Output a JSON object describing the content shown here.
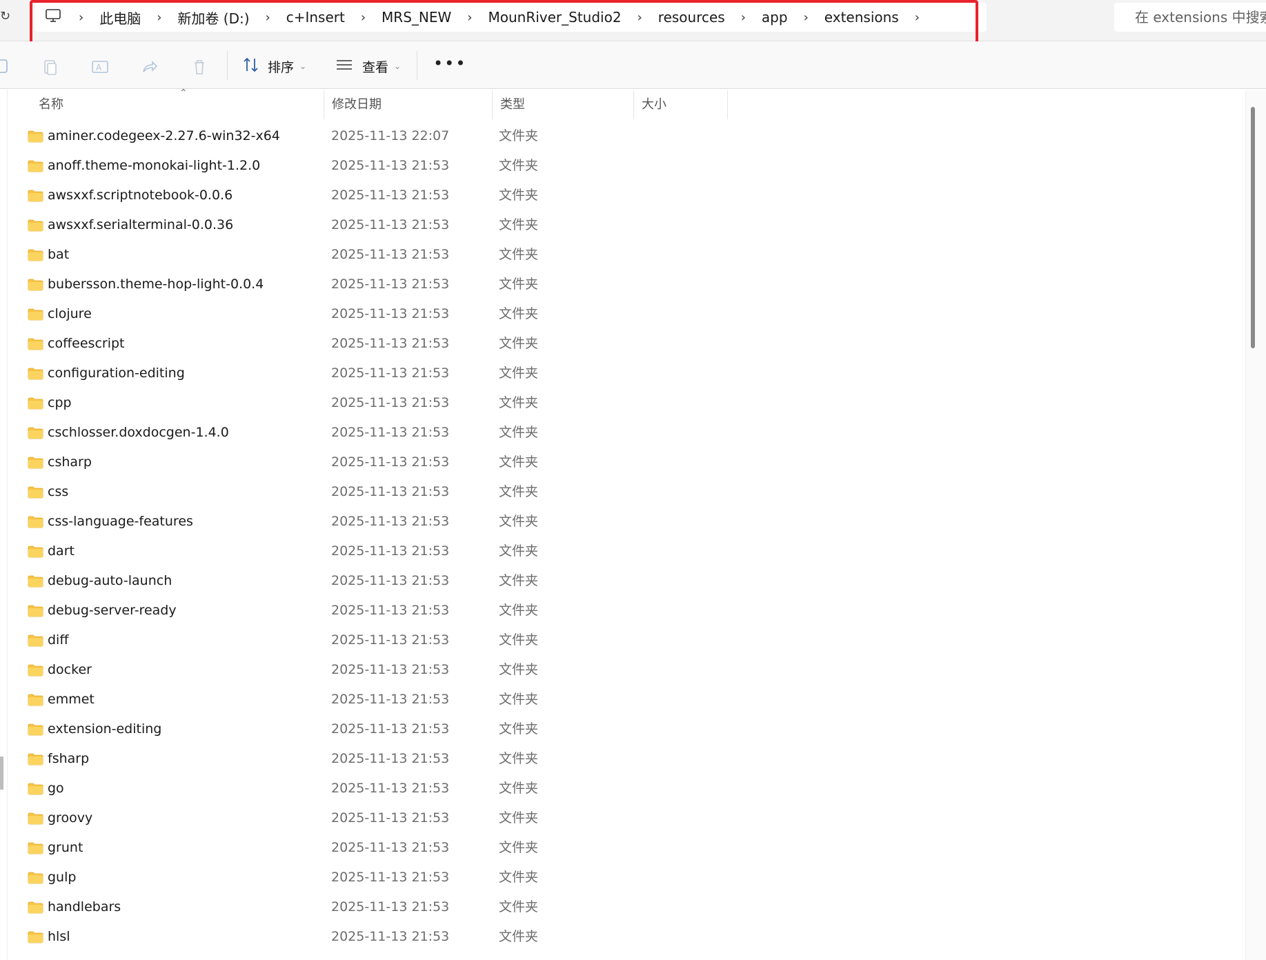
{
  "address_bar": {
    "segments": [
      "此电脑",
      "新加卷 (D:)",
      "c+Insert",
      "MRS_NEW",
      "MounRiver_Studio2",
      "resources",
      "app",
      "extensions"
    ],
    "search_placeholder": "在 extensions 中搜索"
  },
  "toolbar": {
    "sort_label": "排序",
    "view_label": "查看",
    "more_label": "•••"
  },
  "columns": {
    "name": "名称",
    "date": "修改日期",
    "type": "类型",
    "size": "大小"
  },
  "files": [
    {
      "name": "aminer.codegeex-2.27.6-win32-x64",
      "date": "2025-11-13 22:07",
      "type": "文件夹"
    },
    {
      "name": "anoff.theme-monokai-light-1.2.0",
      "date": "2025-11-13 21:53",
      "type": "文件夹"
    },
    {
      "name": "awsxxf.scriptnotebook-0.0.6",
      "date": "2025-11-13 21:53",
      "type": "文件夹"
    },
    {
      "name": "awsxxf.serialterminal-0.0.36",
      "date": "2025-11-13 21:53",
      "type": "文件夹"
    },
    {
      "name": "bat",
      "date": "2025-11-13 21:53",
      "type": "文件夹"
    },
    {
      "name": "bubersson.theme-hop-light-0.0.4",
      "date": "2025-11-13 21:53",
      "type": "文件夹"
    },
    {
      "name": "clojure",
      "date": "2025-11-13 21:53",
      "type": "文件夹"
    },
    {
      "name": "coffeescript",
      "date": "2025-11-13 21:53",
      "type": "文件夹"
    },
    {
      "name": "configuration-editing",
      "date": "2025-11-13 21:53",
      "type": "文件夹"
    },
    {
      "name": "cpp",
      "date": "2025-11-13 21:53",
      "type": "文件夹"
    },
    {
      "name": "cschlosser.doxdocgen-1.4.0",
      "date": "2025-11-13 21:53",
      "type": "文件夹"
    },
    {
      "name": "csharp",
      "date": "2025-11-13 21:53",
      "type": "文件夹"
    },
    {
      "name": "css",
      "date": "2025-11-13 21:53",
      "type": "文件夹"
    },
    {
      "name": "css-language-features",
      "date": "2025-11-13 21:53",
      "type": "文件夹"
    },
    {
      "name": "dart",
      "date": "2025-11-13 21:53",
      "type": "文件夹"
    },
    {
      "name": "debug-auto-launch",
      "date": "2025-11-13 21:53",
      "type": "文件夹"
    },
    {
      "name": "debug-server-ready",
      "date": "2025-11-13 21:53",
      "type": "文件夹"
    },
    {
      "name": "diff",
      "date": "2025-11-13 21:53",
      "type": "文件夹"
    },
    {
      "name": "docker",
      "date": "2025-11-13 21:53",
      "type": "文件夹"
    },
    {
      "name": "emmet",
      "date": "2025-11-13 21:53",
      "type": "文件夹"
    },
    {
      "name": "extension-editing",
      "date": "2025-11-13 21:53",
      "type": "文件夹"
    },
    {
      "name": "fsharp",
      "date": "2025-11-13 21:53",
      "type": "文件夹"
    },
    {
      "name": "go",
      "date": "2025-11-13 21:53",
      "type": "文件夹"
    },
    {
      "name": "groovy",
      "date": "2025-11-13 21:53",
      "type": "文件夹"
    },
    {
      "name": "grunt",
      "date": "2025-11-13 21:53",
      "type": "文件夹"
    },
    {
      "name": "gulp",
      "date": "2025-11-13 21:53",
      "type": "文件夹"
    },
    {
      "name": "handlebars",
      "date": "2025-11-13 21:53",
      "type": "文件夹"
    },
    {
      "name": "hlsl",
      "date": "2025-11-13 21:53",
      "type": "文件夹"
    }
  ],
  "colors": {
    "highlight_border": "#e8232a",
    "folder": "#f8c443"
  }
}
